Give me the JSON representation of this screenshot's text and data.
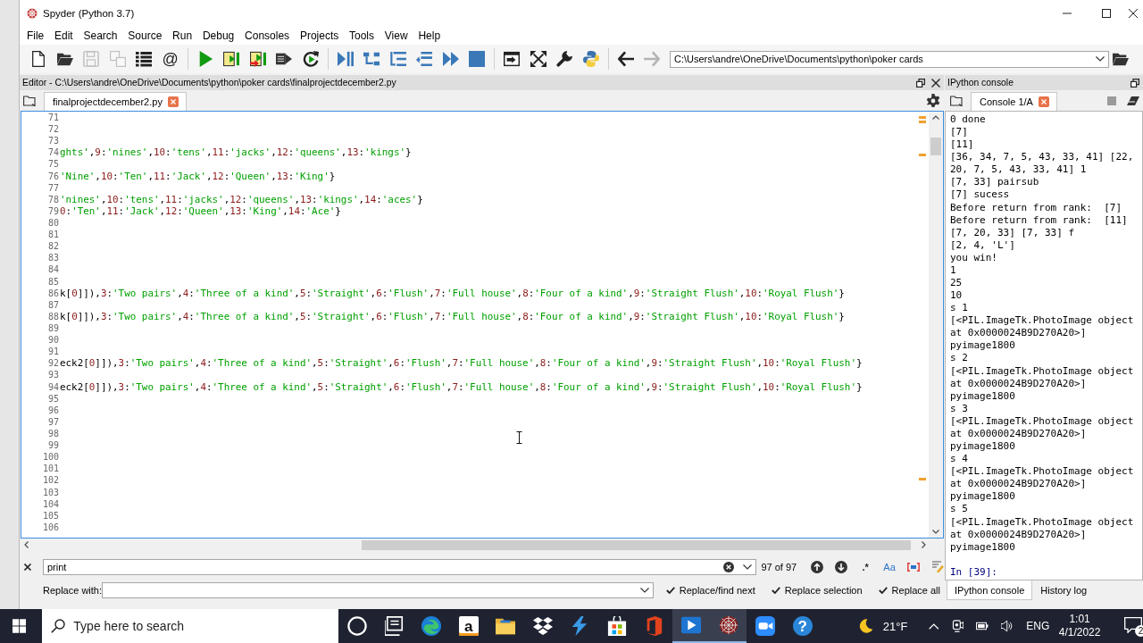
{
  "window": {
    "title": "Spyder (Python 3.7)"
  },
  "menu": [
    "File",
    "Edit",
    "Search",
    "Source",
    "Run",
    "Debug",
    "Consoles",
    "Projects",
    "Tools",
    "View",
    "Help"
  ],
  "toolbar": {
    "groups": [
      [
        {
          "kind": "new_file",
          "disabled": false
        },
        {
          "kind": "open_file",
          "disabled": false
        },
        {
          "kind": "save",
          "disabled": true
        },
        {
          "kind": "save_all",
          "disabled": true
        },
        {
          "kind": "outline",
          "disabled": false
        },
        {
          "kind": "symbol",
          "label": "@",
          "disabled": false
        }
      ],
      [
        {
          "kind": "run",
          "disabled": false
        },
        {
          "kind": "run_cell",
          "disabled": false
        },
        {
          "kind": "run_cell_advance",
          "disabled": false
        },
        {
          "kind": "run_selection",
          "disabled": false
        },
        {
          "kind": "rerun",
          "disabled": false
        }
      ],
      [
        {
          "kind": "debug",
          "disabled": false
        },
        {
          "kind": "step",
          "disabled": false
        },
        {
          "kind": "step_into",
          "disabled": false
        },
        {
          "kind": "step_return",
          "disabled": false
        },
        {
          "kind": "continue",
          "disabled": false
        },
        {
          "kind": "stop",
          "disabled": false
        }
      ],
      [
        {
          "kind": "maximize",
          "disabled": false
        },
        {
          "kind": "fullscreen",
          "disabled": false
        },
        {
          "kind": "preferences",
          "disabled": false
        },
        {
          "kind": "python_path",
          "disabled": false
        }
      ],
      [
        {
          "kind": "back",
          "disabled": false
        },
        {
          "kind": "forward",
          "disabled": true
        }
      ]
    ],
    "working_directory": "C:\\Users\\andre\\OneDrive\\Documents\\python\\poker cards"
  },
  "editor": {
    "pane_title": "Editor - C:\\Users\\andre\\OneDrive\\Documents\\python\\poker cards\\finalprojectdecember2.py",
    "tabs": [
      {
        "label": "finalprojectdecember2.py",
        "selected": true
      }
    ],
    "lines": [
      {
        "number": "71"
      },
      {
        "number": "72"
      },
      {
        "number": "73"
      },
      {
        "number": "74",
        "code": "ghts',9:'nines',10:'tens',11:'jacks',12:'queens',13:'kings'}",
        "starts_in_string": true
      },
      {
        "number": "75"
      },
      {
        "number": "76",
        "code": "'Nine',10:'Ten',11:'Jack',12:'Queen',13:'King'}",
        "starts_in_string": false
      },
      {
        "number": "77"
      },
      {
        "number": "78",
        "code": "'nines',10:'tens',11:'jacks',12:'queens',13:'kings',14:'aces'}",
        "starts_in_string": false
      },
      {
        "number": "79",
        "code": "0:'Ten',11:'Jack',12:'Queen',13:'King',14:'Ace'}",
        "starts_in_string": false
      },
      {
        "number": "80"
      },
      {
        "number": "81"
      },
      {
        "number": "82"
      },
      {
        "number": "83"
      },
      {
        "number": "84"
      },
      {
        "number": "85"
      },
      {
        "number": "86",
        "code": "k[0]]),3:'Two pairs',4:'Three of a kind',5:'Straight',6:'Flush',7:'Full house',8:'Four of a kind',9:'Straight Flush',10:'Royal Flush'}",
        "starts_in_string": false
      },
      {
        "number": "87"
      },
      {
        "number": "88",
        "code": "k[0]]),3:'Two pairs',4:'Three of a kind',5:'Straight',6:'Flush',7:'Full house',8:'Four of a kind',9:'Straight Flush',10:'Royal Flush'}",
        "starts_in_string": false
      },
      {
        "number": "89"
      },
      {
        "number": "90"
      },
      {
        "number": "91"
      },
      {
        "number": "92",
        "code": "eck2[0]]),3:'Two pairs',4:'Three of a kind',5:'Straight',6:'Flush',7:'Full house',8:'Four of a kind',9:'Straight Flush',10:'Royal Flush'}",
        "starts_in_string": false
      },
      {
        "number": "93"
      },
      {
        "number": "94",
        "code": "eck2[0]]),3:'Two pairs',4:'Three of a kind',5:'Straight',6:'Flush',7:'Full house',8:'Four of a kind',9:'Straight Flush',10:'Royal Flush'}",
        "starts_in_string": false
      },
      {
        "number": "95"
      },
      {
        "number": "96"
      },
      {
        "number": "97"
      },
      {
        "number": "98"
      },
      {
        "number": "99"
      },
      {
        "number": "100"
      },
      {
        "number": "101"
      },
      {
        "number": "102"
      },
      {
        "number": "103"
      },
      {
        "number": "104"
      },
      {
        "number": "105"
      },
      {
        "number": "106"
      }
    ]
  },
  "find_bar": {
    "search_value": "print",
    "match_count": "97 of 97",
    "regex_label": ".*",
    "case_label": "Aa",
    "replace_label": "Replace with:",
    "buttons": [
      "Replace/find next",
      "Replace selection",
      "Replace all"
    ]
  },
  "console": {
    "pane_title": "IPython console",
    "tabs": [
      {
        "label": "Console 1/A",
        "selected": true
      }
    ],
    "output": [
      "0 done",
      "[7]",
      "[11]",
      "[36, 34, 7, 5, 43, 33, 41] [22,",
      "20, 7, 5, 43, 33, 41] 1",
      "[7, 33] pairsub",
      "[7] sucess",
      "Before return from rank:  [7]",
      "Before return from rank:  [11]",
      "[7, 20, 33] [7, 33] f",
      "[2, 4, 'L']",
      "you win!",
      "1",
      "25",
      "10",
      "s 1",
      "[<PIL.ImageTk.PhotoImage object",
      "at 0x0000024B9D270A20>]",
      "pyimage1800",
      "s 2",
      "[<PIL.ImageTk.PhotoImage object",
      "at 0x0000024B9D270A20>]",
      "pyimage1800",
      "s 3",
      "[<PIL.ImageTk.PhotoImage object",
      "at 0x0000024B9D270A20>]",
      "pyimage1800",
      "s 4",
      "[<PIL.ImageTk.PhotoImage object",
      "at 0x0000024B9D270A20>]",
      "pyimage1800",
      "s 5",
      "[<PIL.ImageTk.PhotoImage object",
      "at 0x0000024B9D270A20>]",
      "pyimage1800"
    ],
    "prompt": "In [39]:",
    "bottom_tabs": [
      {
        "label": "IPython console",
        "selected": true
      },
      {
        "label": "History log",
        "selected": false
      }
    ]
  },
  "taskbar": {
    "search_placeholder": "Type here to search",
    "apps": [
      {
        "kind": "cortana",
        "active": false
      },
      {
        "kind": "task_view",
        "active": false
      },
      {
        "kind": "edge",
        "active": false
      },
      {
        "kind": "amazon",
        "label": "a",
        "active": false
      },
      {
        "kind": "explorer",
        "active": false
      },
      {
        "kind": "dropbox",
        "active": false
      },
      {
        "kind": "bolt",
        "active": false
      },
      {
        "kind": "store",
        "active": false
      },
      {
        "kind": "office",
        "active": false
      },
      {
        "kind": "media",
        "active": true
      },
      {
        "kind": "spyder",
        "active": true
      },
      {
        "kind": "zoom",
        "active": false
      },
      {
        "kind": "help",
        "label": "?",
        "active": false
      }
    ],
    "weather": "21°F",
    "language": "ENG",
    "time": "1:01",
    "date": "4/1/2022",
    "notification_count": "2"
  }
}
